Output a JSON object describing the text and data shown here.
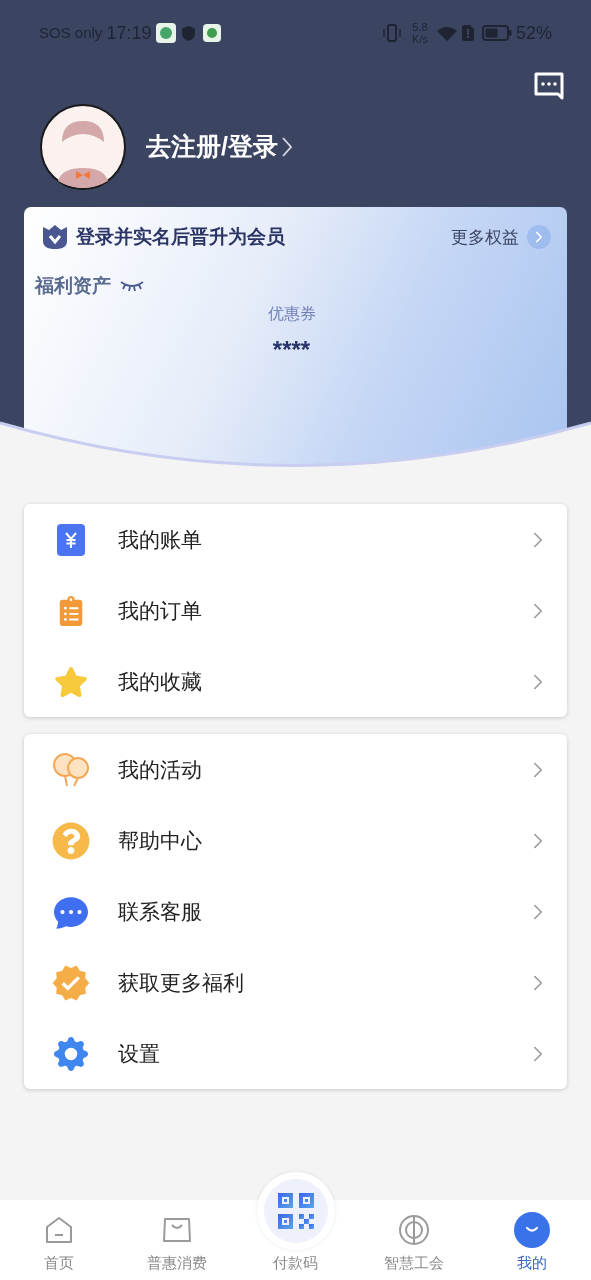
{
  "status_bar": {
    "carrier": "SOS only",
    "time": "17:19",
    "speed_value": "5.8",
    "speed_unit": "K/s",
    "battery": "52%"
  },
  "profile": {
    "login_link": "去注册/登录"
  },
  "member_card": {
    "title": "登录并实名后晋升为会员",
    "more_link": "更多权益",
    "assets_label": "福利资产",
    "coupon_label": "优惠券",
    "coupon_value": "****"
  },
  "menu_groups": [
    {
      "items": [
        {
          "kind": "bill",
          "label": "我的账单"
        },
        {
          "kind": "orders",
          "label": "我的订单"
        },
        {
          "kind": "favorites",
          "label": "我的收藏"
        }
      ]
    },
    {
      "items": [
        {
          "kind": "activities",
          "label": "我的活动"
        },
        {
          "kind": "help",
          "label": "帮助中心"
        },
        {
          "kind": "service",
          "label": "联系客服"
        },
        {
          "kind": "benefits",
          "label": "获取更多福利"
        },
        {
          "kind": "settings",
          "label": "设置"
        }
      ]
    }
  ],
  "bottom_nav": [
    {
      "kind": "home",
      "label": "首页",
      "selected": false
    },
    {
      "kind": "shop",
      "label": "普惠消费",
      "selected": false
    },
    {
      "kind": "pay",
      "label": "付款码",
      "selected": false
    },
    {
      "kind": "union",
      "label": "智慧工会",
      "selected": false
    },
    {
      "kind": "mine",
      "label": "我的",
      "selected": true
    }
  ]
}
